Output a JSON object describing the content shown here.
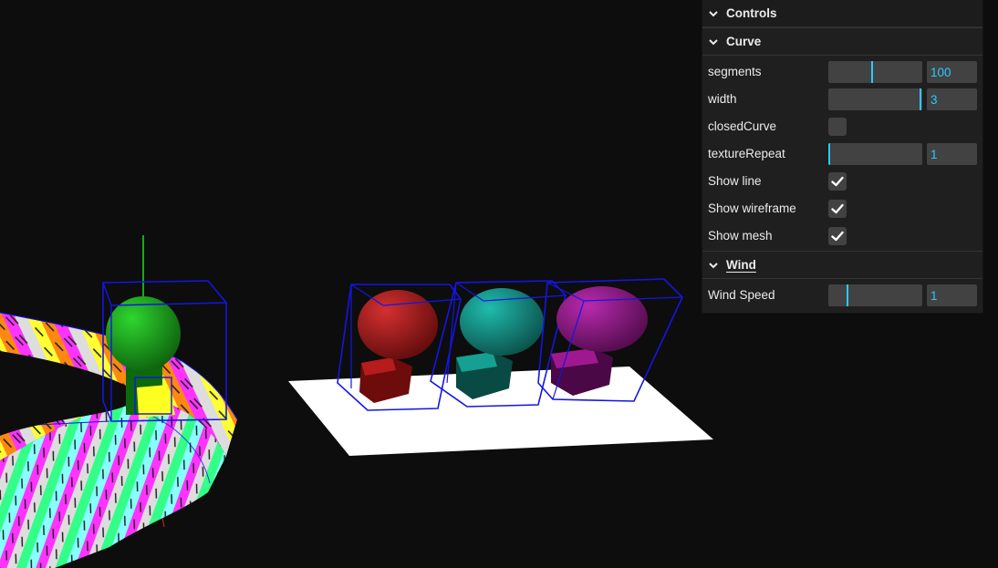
{
  "controls": {
    "title": "Controls",
    "curve": {
      "title": "Curve",
      "segments": {
        "label": "segments",
        "value": "100",
        "fraction": 0.47
      },
      "width": {
        "label": "width",
        "value": "3",
        "fraction": 0.99
      },
      "closed_curve": {
        "label": "closedCurve",
        "checked": false
      },
      "texture_repeat": {
        "label": "textureRepeat",
        "value": "1",
        "fraction": 0.0
      },
      "show_line": {
        "label": "Show line",
        "checked": true
      },
      "show_wireframe": {
        "label": "Show wireframe",
        "checked": true
      },
      "show_mesh": {
        "label": "Show mesh",
        "checked": true
      }
    },
    "wind": {
      "title": "Wind",
      "speed": {
        "label": "Wind Speed",
        "value": "1",
        "fraction": 0.2
      }
    }
  },
  "scene": {
    "colors": {
      "background": "#0d0d0d",
      "accent": "#2cc9ff",
      "wireframe": "#1515e6",
      "green_figure": "#109010",
      "red_figure": "#a01818",
      "teal_figure": "#158a80",
      "purple_figure": "#8c1480",
      "ground_plane": "#ffffff",
      "track_stripes": [
        "#ff33ff",
        "#ffff33",
        "#ff8811",
        "#88ffff",
        "#dddddd",
        "#33ff88"
      ]
    }
  }
}
